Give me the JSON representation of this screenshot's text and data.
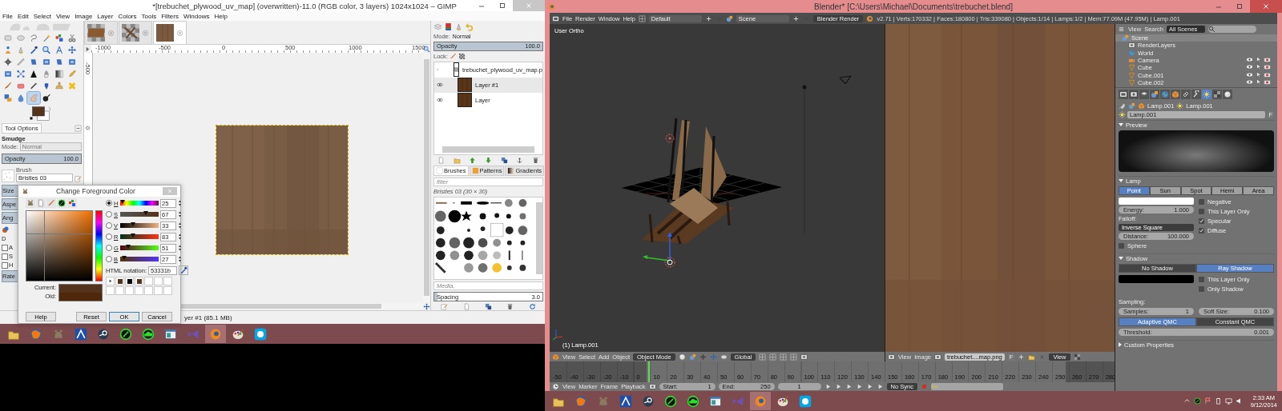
{
  "gimp": {
    "title": "*[trebuchet_plywood_uv_map] (overwritten)-11.0 (RGB color, 3 layers) 1024x1024 – GIMP",
    "menu": [
      "File",
      "Edit",
      "Select",
      "View",
      "Image",
      "Layer",
      "Colors",
      "Tools",
      "Filters",
      "Windows",
      "Help"
    ],
    "tools": [
      {
        "selected": false
      },
      {
        "selected": false
      },
      {
        "selected": false
      },
      {
        "selected": false
      },
      {
        "selected": false
      },
      {
        "selected": false
      },
      {
        "selected": false
      },
      {
        "selected": false
      },
      {
        "selected": false
      },
      {
        "selected": false
      },
      {
        "selected": false
      },
      {
        "selected": false
      },
      {
        "selected": false
      },
      {
        "selected": false
      },
      {
        "selected": false
      },
      {
        "selected": false
      },
      {
        "selected": false
      },
      {
        "selected": false
      },
      {
        "selected": false
      },
      {
        "selected": false
      },
      {
        "selected": false
      },
      {
        "selected": false
      },
      {
        "selected": false
      },
      {
        "selected": false
      },
      {
        "selected": false
      },
      {
        "selected": false
      },
      {
        "selected": false
      },
      {
        "selected": false
      },
      {
        "selected": false
      },
      {
        "selected": false
      },
      {
        "selected": false
      },
      {
        "selected": false
      },
      {
        "selected": true
      },
      {
        "selected": false
      }
    ],
    "image_tabs": [
      {
        "selected": false
      },
      {
        "selected": false
      },
      {
        "selected": true
      }
    ],
    "ruler_labels": [
      "-1000",
      "-500",
      "0",
      "500",
      "1000",
      "1500"
    ],
    "vruler_labels": [
      "-500",
      "0"
    ],
    "tool_options": {
      "title": "Tool Options",
      "tool": "Smudge",
      "mode_label": "Mode:",
      "mode": "Normal",
      "opacity": {
        "label": "Opacity",
        "value": "100.0",
        "level": 1
      },
      "brush_label": "Brush",
      "brush": "Bristles 03",
      "side_buttons": [
        "Size",
        "Aspe",
        "Ang"
      ],
      "dynamics": "D",
      "checks": [
        {
          "label": "A",
          "checked": false
        },
        {
          "label": "S",
          "checked": false
        },
        {
          "label": "H",
          "checked": false
        }
      ],
      "rate": "Rate"
    },
    "color_dialog": {
      "title": "Change Foreground Color",
      "channels": [
        {
          "label": "H",
          "selected": true,
          "value": "25",
          "level": 0.07
        },
        {
          "label": "S",
          "selected": false,
          "value": "67",
          "level": 0.67
        },
        {
          "label": "V",
          "selected": false,
          "value": "33",
          "level": 0.33
        },
        {
          "label": "R",
          "selected": false,
          "value": "83",
          "level": 0.33
        },
        {
          "label": "G",
          "selected": false,
          "value": "51",
          "level": 0.2
        },
        {
          "label": "B",
          "selected": false,
          "value": "27",
          "level": 0.11
        }
      ],
      "html_label": "HTML notation:",
      "html": "53331b",
      "history": [
        {
          "color": "#53331b"
        },
        {
          "color": "#000000"
        },
        {
          "color": "#53331b"
        }
      ],
      "current_label": "Current:",
      "old_label": "Old:",
      "buttons": [
        "Help",
        "Reset",
        "OK",
        "Cancel"
      ]
    },
    "status": "yer #1 (85.1 MB)",
    "layers_panel": {
      "mode_label": "Mode:",
      "mode": "Normal",
      "opacity": {
        "label": "Opacity",
        "value": "100.0",
        "level": 1
      },
      "lock_label": "Lock:",
      "layers": [
        {
          "name": "trebuchet_plywood_uv_map.p",
          "kind": "transparent",
          "selected": false
        },
        {
          "name": "Layer #1",
          "kind": "wood",
          "selected": true
        },
        {
          "name": "Layer",
          "kind": "wood",
          "selected": false
        }
      ]
    },
    "brushes_panel": {
      "tabs": [
        {
          "label": "Brushes",
          "selected": true
        },
        {
          "label": "Patterns",
          "selected": false
        },
        {
          "label": "Gradients",
          "selected": false
        }
      ],
      "filter_placeholder": "filter",
      "current": "Bristles 03 (30 × 30)",
      "tag": "Media,",
      "spacing": {
        "label": "Spacing",
        "value": "3.0",
        "level": 0.03
      }
    }
  },
  "left_taskbar": {
    "apps": [
      {
        "selected": false
      },
      {
        "selected": false
      },
      {
        "selected": false
      },
      {
        "selected": false
      },
      {
        "selected": false
      },
      {
        "selected": false
      },
      {
        "selected": false
      },
      {
        "selected": false
      },
      {
        "selected": false
      },
      {
        "selected": true
      },
      {
        "selected": false
      },
      {
        "selected": false
      }
    ]
  },
  "blender": {
    "title": "Blender* [C:\\Users\\Michael\\Documents\\trebuchet.blend]",
    "menu": [
      "File",
      "Render",
      "Window",
      "Help"
    ],
    "layout": "Default",
    "scene": "Scene",
    "engine": "Blender Render",
    "stats": "v2.71 | Verts:170332 | Faces:180800 | Tris:339080 | Objects:1/14 | Lamps:1/2 | Mem:77.09M (47.95M) | Lamp.001",
    "viewport": {
      "label": "User Ortho",
      "object": "(1) Lamp.001"
    },
    "view3d_header": {
      "menu": [
        "View",
        "Select",
        "Add",
        "Object"
      ],
      "mode": "Object Mode",
      "orientation": "Global"
    },
    "image_header": {
      "menu": [
        "View",
        "Image"
      ],
      "image": "trebuchet....map.png",
      "fake_user": "F",
      "view": "View"
    },
    "outliner": {
      "menu": [
        "View",
        "Search"
      ],
      "filter": "All Scenes",
      "tree": [
        {
          "name": "Scene",
          "selected": true,
          "children": [
            {
              "name": "RenderLayers",
              "selected": false
            },
            {
              "name": "World",
              "selected": false
            },
            {
              "name": "Camera",
              "selected": false
            },
            {
              "name": "Cube",
              "selected": false
            },
            {
              "name": "Cube.001",
              "selected": false
            },
            {
              "name": "Cube.002",
              "selected": false
            }
          ]
        }
      ]
    },
    "properties": {
      "context_tabs": [
        {
          "selected": false
        },
        {
          "selected": false
        },
        {
          "selected": false
        },
        {
          "selected": false
        },
        {
          "selected": false
        },
        {
          "selected": false
        },
        {
          "selected": false
        },
        {
          "selected": true
        },
        {
          "selected": false
        },
        {
          "selected": false
        }
      ],
      "path": [
        "Lamp.001",
        "Lamp.001"
      ],
      "datablock": "Lamp.001",
      "fake_user": "F",
      "preview": {
        "title": "Preview",
        "expanded": true
      },
      "lamp": {
        "title": "Lamp",
        "expanded": true,
        "types": [
          {
            "label": "Point",
            "selected": true
          },
          {
            "label": "Sun",
            "selected": false
          },
          {
            "label": "Spot",
            "selected": false
          },
          {
            "label": "Hemi",
            "selected": false
          },
          {
            "label": "Area",
            "selected": false
          }
        ],
        "energy": {
          "label": "Energy:",
          "value": "1.000"
        },
        "falloff_label": "Falloff:",
        "falloff": "Inverse Square",
        "distance": {
          "label": "Distance:",
          "value": "100.000"
        },
        "sphere": {
          "label": "Sphere",
          "checked": false
        },
        "options": [
          {
            "label": "Negative",
            "checked": false
          },
          {
            "label": "This Layer Only",
            "checked": false
          },
          {
            "label": "Specular",
            "checked": true
          },
          {
            "label": "Diffuse",
            "checked": true
          }
        ]
      },
      "shadow": {
        "title": "Shadow",
        "expanded": true,
        "types": [
          {
            "label": "No Shadow",
            "selected": false
          },
          {
            "label": "Ray Shadow",
            "selected": true
          }
        ],
        "options": [
          {
            "label": "This Layer Only",
            "checked": false
          },
          {
            "label": "Only Shadow",
            "checked": false
          }
        ],
        "sampling_label": "Sampling:",
        "samples": {
          "label": "Samples:",
          "value": "1"
        },
        "soft_size": {
          "label": "Soft Size:",
          "value": "0.100"
        },
        "methods": [
          {
            "label": "Adaptive QMC",
            "selected": true
          },
          {
            "label": "Constant QMC",
            "selected": false
          }
        ],
        "threshold": {
          "label": "Threshold:",
          "value": "0.001"
        }
      },
      "custom": {
        "title": "Custom Properties",
        "expanded": false
      }
    },
    "timeline": {
      "ticks": [
        "-50",
        "-40",
        "-30",
        "-20",
        "-10",
        "0",
        "10",
        "20",
        "30",
        "40",
        "50",
        "60",
        "70",
        "80",
        "90",
        "100",
        "110",
        "120",
        "130",
        "140",
        "150",
        "160",
        "170",
        "180",
        "190",
        "200",
        "210",
        "220",
        "230",
        "240",
        "250",
        "260",
        "270",
        "280"
      ],
      "menu": [
        "View",
        "Marker",
        "Frame",
        "Playback"
      ],
      "start": {
        "label": "Start:",
        "value": "1"
      },
      "end": {
        "label": "End:",
        "value": "250"
      },
      "current": "1",
      "sync": "No Sync"
    }
  },
  "right_taskbar": {
    "apps": [
      {
        "selected": false
      },
      {
        "selected": false
      },
      {
        "selected": false
      },
      {
        "selected": false
      },
      {
        "selected": false
      },
      {
        "selected": false
      },
      {
        "selected": false
      },
      {
        "selected": false
      },
      {
        "selected": false
      },
      {
        "selected": true
      },
      {
        "selected": false
      },
      {
        "selected": false
      }
    ],
    "time": "2:33 AM",
    "date": "9/12/2014"
  }
}
